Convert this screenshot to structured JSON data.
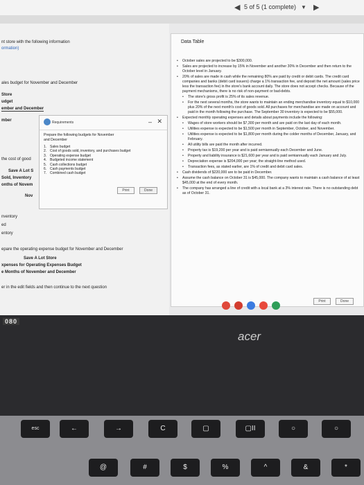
{
  "topbar": {
    "progress": "5 of 5 (1 complete)",
    "back": "◀",
    "forward": "▶",
    "dropdown": "▼"
  },
  "left": {
    "header1": "nt store with the following information",
    "header2": "ormation)",
    "l1": "ales budget for November and December",
    "l2": "Store",
    "l3": "udget",
    "l4": "ember and December",
    "l5": "mber",
    "l6": "the cost of good",
    "l7": "Save A Lot S",
    "l8": "Sold, Inventory",
    "l9": "onths of Novem",
    "l10": "Nov",
    "l11": "nventory",
    "l12": "ed",
    "l13": "entory",
    "l14": "epare the operating expense budget for November and December",
    "l15": "Save A Lot Store",
    "l16": "xpenses for Operating Expenses Budget",
    "l17": "e Months of November and December",
    "l18": "er in the edit fields and then continue to the next question"
  },
  "data_table": {
    "title": "Data Table",
    "items": [
      "October sales are projected to be $300,000.",
      "Sales are projected to increase by 15% in November and another 30% in December and then return to the October level in January.",
      "20% of sales are made in cash while the remaining 80% are paid by credit or debit cards. The credit card companies and banks (debit card issuers) charge a 1% transaction fee, and deposit the net amount (sales price less the transaction fee) in the store's bank account daily. The store does not accept checks. Because of the payment mechanisms, there is no risk of non-payment or bad-debts.",
      "The store's gross profit is 25% of its sales revenue.",
      "For the next several months, the store wants to maintain an ending merchandise inventory equal to $10,000 plus 20% of the next month's cost of goods sold. All purchases for merchandise are made on account and paid in the month following the purchase. The September 30 inventory is expected to be $55,000.",
      "Expected monthly operating expenses and details about payments include the following:",
      "Wages of store workers should be $7,300 per month and are paid on the last day of each month.",
      "Utilities expense is expected to be $1,500 per month in September, October, and November.",
      "Utilities expense is expected to be $1,800 per month during the colder months of December, January, and February.",
      "All utility bills are paid the month after incurred.",
      "Property tax is $19,200 per year and is paid semiannually each December and June.",
      "Property and liability insurance is $21,600 per year and is paid semiannually each January and July.",
      "Depreciation expense is $204,000 per year; the straight-line method used.",
      "Transaction fees, as stated earlier, are 1% of credit and debit card sales.",
      "Cash dividends of $220,000 are to be paid in December.",
      "Assume the cash balance on October 31 is $45,000. The company wants to maintain a cash balance of at least $45,000 at the end of every month.",
      "The company has arranged a line of credit with a local bank at a 3% interest rate. There is no outstanding debt as of October 31."
    ],
    "print": "Print",
    "done": "Done"
  },
  "modal": {
    "title": "Requirements",
    "minimize": "–",
    "close": "✕",
    "intro": "Prepare the following budgets for November and December",
    "requirements": [
      {
        "num": "1.",
        "text": "Sales budget"
      },
      {
        "num": "2.",
        "text": "Cost of goods sold, inventory, and purchases budget"
      },
      {
        "num": "3.",
        "text": "Operating expense budget"
      },
      {
        "num": "4.",
        "text": "Budgeted income statement"
      },
      {
        "num": "5.",
        "text": "Cash collections budget"
      },
      {
        "num": "6.",
        "text": "Cash payments budget"
      },
      {
        "num": "7.",
        "text": "Combined cash budget"
      }
    ],
    "print": "Print",
    "done": "Done"
  },
  "laptop": {
    "brand": "acer",
    "chip": "080"
  },
  "keys": [
    "esc",
    "←",
    "→",
    "C",
    "▢",
    "▢II",
    "○",
    "○",
    "@",
    "#",
    "$",
    "%",
    "^",
    "&",
    "*"
  ]
}
